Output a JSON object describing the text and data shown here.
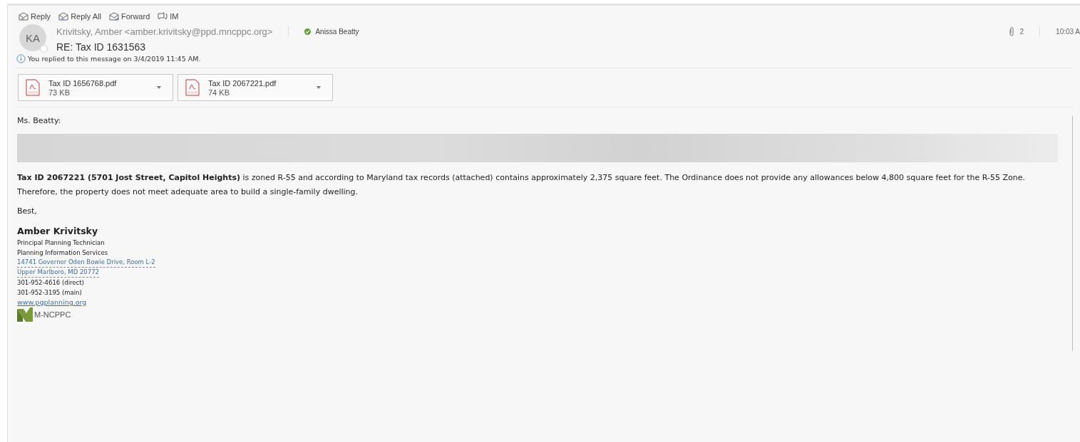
{
  "actions": [
    {
      "label": "Reply",
      "kind": "reply"
    },
    {
      "label": "Reply All",
      "kind": "replyall"
    },
    {
      "label": "Forward",
      "kind": "forward"
    },
    {
      "label": "IM",
      "kind": "im"
    }
  ],
  "header": {
    "initials": "KA",
    "sender": "Krivitsky, Amber <amber.krivitsky@ppd.mncppc.org>",
    "recipient": "Anissa Beatty",
    "subject": "RE: Tax ID 1631563",
    "attachment_count": "2",
    "time": "10:03 A"
  },
  "info": "You replied to this message on 3/4/2019 11:45 AM.",
  "attachments": [
    {
      "name": "Tax ID 1656768.pdf",
      "size": "73 KB"
    },
    {
      "name": "Tax ID 2067221.pdf",
      "size": "74 KB"
    }
  ],
  "body": {
    "greeting": "Ms. Beatty:",
    "paragraph": "**Tax ID 2067221 (5701 Jost Street, Capitol Heights)** is zoned R-55 and according to Maryland tax records (attached) contains approximately 2,375 square feet. The Ordinance does not provide any allowances below 4,800 square feet for the R-55 Zone. Therefore, the property does not meet adequate area to build a single-family dwelling.",
    "closing": "Best,"
  },
  "signature": {
    "name": "Amber Krivitsky",
    "lines": [
      {
        "text": "Principal Planning Technician",
        "kind": "text"
      },
      {
        "text": "Planning Information Services",
        "kind": "text"
      },
      {
        "text": "14741 Governor Oden Bowie Drive, Room L-2",
        "kind": "address"
      },
      {
        "text": "Upper Marlboro, MD 20772",
        "kind": "address"
      },
      {
        "text": "301-952-4616 (direct)",
        "kind": "text"
      },
      {
        "text": "301-952-3195 (main)",
        "kind": "text"
      },
      {
        "text": "www.pgplanning.org",
        "kind": "link"
      }
    ],
    "logo": "M-NCPPC"
  }
}
